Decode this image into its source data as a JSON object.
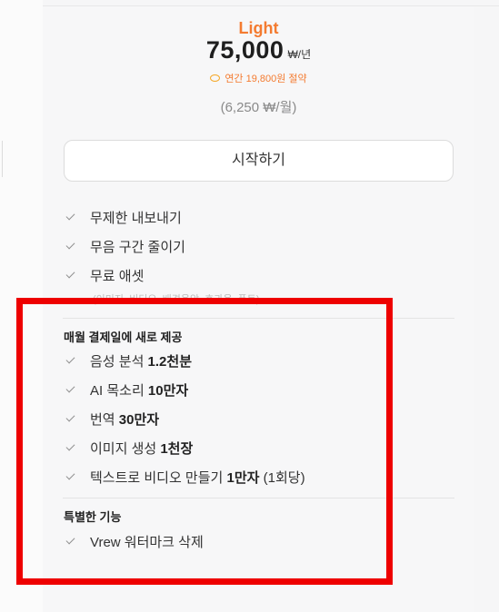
{
  "plan": {
    "name": "Light",
    "price": "75,000",
    "price_unit": "₩/년",
    "savings": "연간 19,800원 절약",
    "monthly_equiv": "(6,250 ₩/월)",
    "start_button": "시작하기",
    "accent_color": "#f47b30"
  },
  "features": [
    {
      "text": "무제한 내보내기"
    },
    {
      "text": "무음 구간 줄이기"
    },
    {
      "text": "무료 애셋",
      "sub": "(이미지, 비디오, 배경음악, 효과음, 폰트)"
    }
  ],
  "monthly_section": {
    "title": "매월 결제일에 새로 제공",
    "items": [
      {
        "label": "음성 분석 ",
        "value": "1.2천분",
        "suffix": ""
      },
      {
        "label": "AI 목소리 ",
        "value": "10만자",
        "suffix": ""
      },
      {
        "label": "번역 ",
        "value": "30만자",
        "suffix": ""
      },
      {
        "label": "이미지 생성 ",
        "value": "1천장",
        "suffix": ""
      },
      {
        "label": "텍스트로 비디오 만들기 ",
        "value": "1만자",
        "suffix": " (1회당)"
      }
    ]
  },
  "special_section": {
    "title": "특별한 기능",
    "items": [
      {
        "label": "Vrew 워터마크 삭제"
      }
    ]
  },
  "annotation": {
    "color": "#ee0000"
  }
}
